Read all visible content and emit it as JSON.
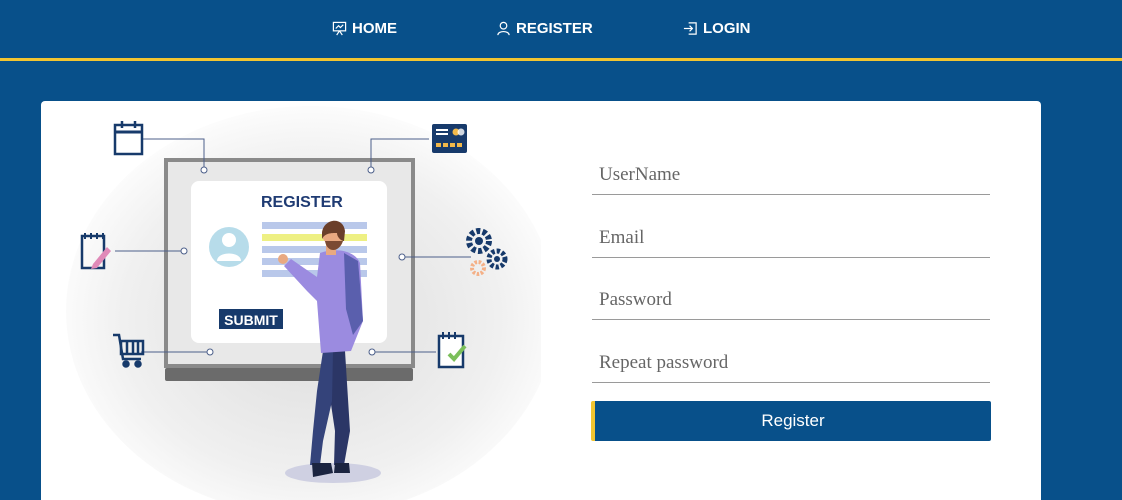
{
  "nav": {
    "home": {
      "label": "HOME",
      "icon": "presentation-chart-icon"
    },
    "register": {
      "label": "REGISTER",
      "icon": "user-icon"
    },
    "login": {
      "label": "LOGIN",
      "icon": "login-arrow-icon"
    }
  },
  "illustration": {
    "screen_title": "REGISTER",
    "submit_label": "SUBMIT",
    "icons": [
      "calendar-icon",
      "credit-card-icon",
      "notepad-pencil-icon",
      "gears-icon",
      "shopping-cart-icon",
      "checklist-icon"
    ]
  },
  "form": {
    "username_placeholder": "UserName",
    "email_placeholder": "Email",
    "password_placeholder": "Password",
    "repeat_password_placeholder": "Repeat password",
    "submit_label": "Register"
  },
  "colors": {
    "brand": "#08508a",
    "accent": "#f2c531",
    "card": "#ffffff",
    "figure_shirt": "#9b8be0",
    "figure_pants": "#2b3666"
  }
}
